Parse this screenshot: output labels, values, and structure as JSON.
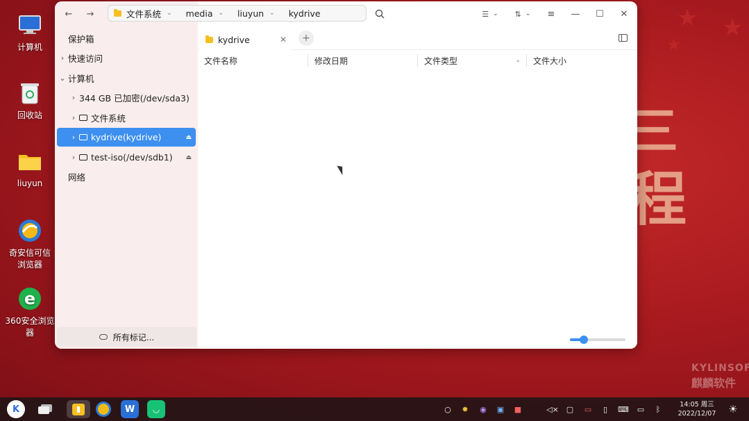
{
  "desktop": {
    "icons": [
      {
        "label": "计算机"
      },
      {
        "label": "回收站"
      },
      {
        "label": "liuyun"
      },
      {
        "label": "奇安信可信\n浏览器"
      },
      {
        "label": "360安全浏览\n器"
      }
    ],
    "wallpaper_text": [
      "三",
      "程"
    ],
    "watermark": [
      "KYLINSOFT",
      "麒麟软件"
    ]
  },
  "toolbar": {
    "breadcrumbs": [
      "文件系统",
      "media",
      "liuyun",
      "kydrive"
    ]
  },
  "sidebar": {
    "vault_label": "保护箱",
    "quick_access_label": "快速访问",
    "computer_label": "计算机",
    "items": [
      {
        "label": "344 GB 已加密(/dev/sda3)"
      },
      {
        "label": "文件系统"
      },
      {
        "label": "kydrive(kydrive)"
      },
      {
        "label": "test-iso(/dev/sdb1)"
      }
    ],
    "network_label": "网络",
    "tags_label": "所有标记..."
  },
  "tabs": [
    {
      "label": "kydrive"
    }
  ],
  "columns": [
    "文件名称",
    "修改日期",
    "文件类型",
    "文件大小"
  ],
  "zoom": {
    "level_percent": 25
  },
  "taskbar": {
    "clock_time": "14:05 周三",
    "clock_date": "2022/12/07"
  },
  "colors": {
    "accent": "#3d8ff0",
    "folder": "#f6c022"
  }
}
